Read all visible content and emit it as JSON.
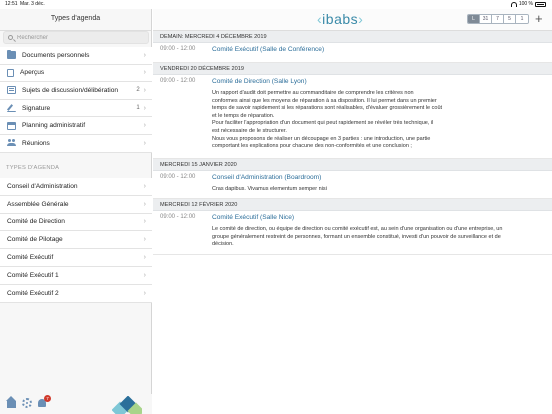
{
  "status_bar": {
    "time": "12:51",
    "date": "Mar. 3 déc.",
    "battery": "100 %"
  },
  "sidebar": {
    "title": "Types d'agenda",
    "search_placeholder": "Rechercher",
    "items": [
      {
        "label": "Documents personnels",
        "icon": "folder-icon",
        "count": ""
      },
      {
        "label": "Aperçus",
        "icon": "document-icon",
        "count": ""
      },
      {
        "label": "Sujets de discussion/délibération",
        "icon": "list-icon",
        "count": "2"
      },
      {
        "label": "Signature",
        "icon": "pen-icon",
        "count": "1"
      },
      {
        "label": "Planning administratif",
        "icon": "calendar-icon",
        "count": ""
      },
      {
        "label": "Réunions",
        "icon": "people-icon",
        "count": ""
      }
    ],
    "section_header": "TYPES D'AGENDA",
    "agenda_types": [
      "Conseil d'Administration",
      "Assemblée Générale",
      "Comité de Direction",
      "Comité de Pilotage",
      "Comité Exécutif",
      "Comité Exécutif 1",
      "Comité Exécutif 2"
    ],
    "notification_count": "7",
    "bottom_icons": [
      "home-icon",
      "gear-icon",
      "bell-icon"
    ]
  },
  "header": {
    "brand": "ibabs",
    "view_buttons": [
      "L",
      "31",
      "7",
      "5",
      "1"
    ],
    "active_view": "L",
    "add_icon": "plus-icon",
    "add_symbol": "+"
  },
  "agenda": [
    {
      "date": "DEMAIN: MERCREDI 4 DÉCEMBRE 2019",
      "meetings": [
        {
          "time": "09:00 - 12:00",
          "title": "Comité Exécutif (Salle de Conférence)",
          "description": ""
        }
      ]
    },
    {
      "date": "VENDREDI 20 DÉCEMBRE 2019",
      "meetings": [
        {
          "time": "09:00 - 12:00",
          "title": "Comité de Direction (Salle Lyon)",
          "description": "Un rapport d'audit doit permettre au commanditaire de comprendre les critères non\nconformes ainsi que les moyens de réparation à sa disposition. Il lui permet dans un premier\ntemps de savoir rapidement si les réparations sont réalisables, d'évaluer grossièrement le coût\net le temps de réparation.\nPour faciliter l'appropriation d'un document qui peut rapidement se révéler très technique, il\nest nécessaire de le structurer.\nNous vous proposons de réaliser un découpage en 3 parties : une introduction, une partie\ncomportant les explications pour chacune des non-conformités et une conclusion ;"
        }
      ]
    },
    {
      "date": "MERCREDI 15 JANVIER 2020",
      "meetings": [
        {
          "time": "09:00 - 12:00",
          "title": "Conseil d'Administration (Boardroom)",
          "description": "Cras dapibus. Vivamus elementum semper nisi"
        }
      ]
    },
    {
      "date": "MERCREDI 12 FÉVRIER 2020",
      "meetings": [
        {
          "time": "09:00 - 12:00",
          "title": "Comité Exécutif (Salle Nice)",
          "description": "Le comité de direction, ou équipe de direction ou comité exécutif est, au sein d'une organisation ou d'une entreprise, un\ngroupe généralement restreint de personnes, formant un ensemble constitué, investi d'un pouvoir de surveillance et de\ndécision."
        }
      ]
    }
  ]
}
